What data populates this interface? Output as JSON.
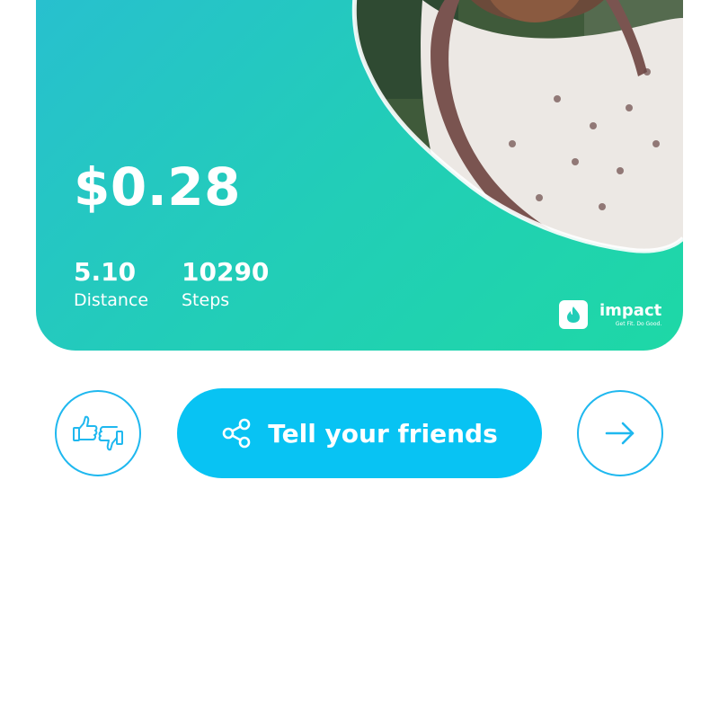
{
  "card": {
    "amount": "$0.28",
    "stats": [
      {
        "value": "5.10",
        "label": "Distance"
      },
      {
        "value": "10290",
        "label": "Steps"
      }
    ],
    "brand": {
      "name": "impact",
      "tagline": "Get Fit. Do Good."
    },
    "photo_subject": "elderly woman in white patterned sari"
  },
  "actions": {
    "vote_icon": "thumbs-up-down-icon",
    "share_label": "Tell your friends",
    "share_icon": "share-icon",
    "next_icon": "arrow-right-icon"
  },
  "colors": {
    "card_gradient_start": "#28bfd0",
    "card_gradient_end": "#1ed8a6",
    "button_blue": "#08c3f3",
    "outline_blue": "#1fb8ef"
  }
}
